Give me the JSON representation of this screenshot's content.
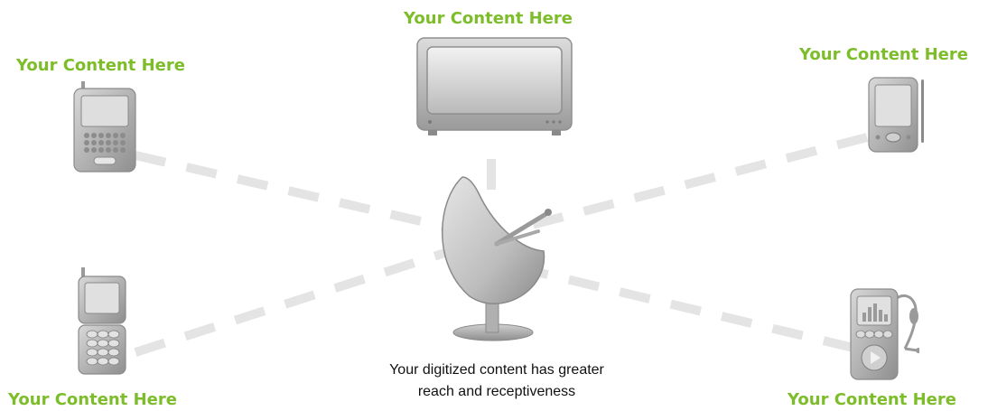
{
  "labels": {
    "top_center": "Your Content Here",
    "top_left": "Your Content Here",
    "top_right": "Your Content Here",
    "bottom_left": "Your Content Here",
    "bottom_right": "Your Content Here"
  },
  "caption": {
    "line1": "Your digitized content has greater",
    "line2": "reach and receptiveness"
  },
  "colors": {
    "label_green": "#7dbd2a",
    "dash_gray": "#e4e4e4",
    "device_gray": "#a8a8a8"
  },
  "icons": [
    "television-icon",
    "smartphone-icon",
    "pda-icon",
    "flip-phone-icon",
    "media-player-headset-icon",
    "satellite-dish-icon"
  ]
}
